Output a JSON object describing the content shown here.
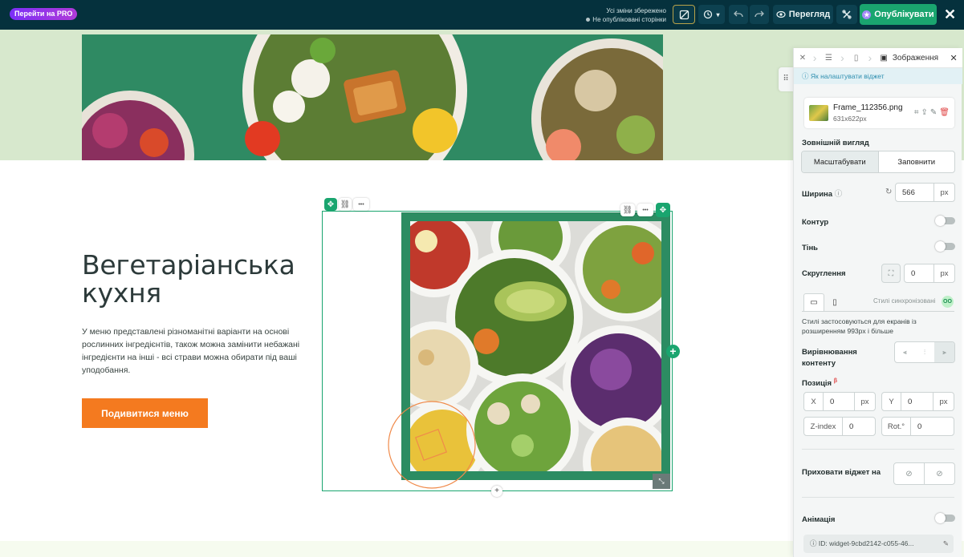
{
  "topbar": {
    "pro_label": "Перейти на PRO",
    "saved_status": "Усі зміни збережено",
    "unpublished_status": "Не опубліковані сторінки",
    "preview_label": "Перегляд",
    "publish_label": "Опублікувати",
    "close_symbol": "✕"
  },
  "hero": {
    "title": "Вегетаріанська кухня",
    "text": "У меню представлені різноманітні варіанти на основі рослинних інгредієнтів, також можна замінити небажані інгредієнти на інші - всі страви можна обирати під ваші уподобання.",
    "button_label": "Подивитися меню"
  },
  "widget": {
    "more_symbol": "•••",
    "plus_symbol": "+"
  },
  "panel": {
    "breadcrumb_current": "Зображення",
    "help_link": "Як налаштувати віджет",
    "file": {
      "name": "Frame_112356.png",
      "size": "631x622px"
    },
    "appearance_label": "Зовнішній вигляд",
    "fit_options": [
      "Масштабувати",
      "Заповнити"
    ],
    "width": {
      "label": "Ширина",
      "value": "566",
      "unit": "px"
    },
    "outline_label": "Контур",
    "shadow_label": "Тінь",
    "radius": {
      "label": "Скруглення",
      "value": "0",
      "unit": "px"
    },
    "styles_synced": "Стилі синхронізовані",
    "sync_badge": "OO",
    "styles_note": "Стилі застосовуються для екранів із розширенням 993px і більше",
    "content_align_label": "Вирівнювання контенту",
    "position_label": "Позиція",
    "beta": "β",
    "x": {
      "label": "X",
      "value": "0",
      "unit": "px"
    },
    "y": {
      "label": "Y",
      "value": "0",
      "unit": "px"
    },
    "zindex": {
      "label": "Z-index",
      "value": "0"
    },
    "rotation": {
      "label": "Rot.°",
      "value": "0"
    },
    "hide_on_label": "Приховати віджет на",
    "animation_label": "Анімація",
    "widget_id": "ID: widget-9cbd2142-c055-46..."
  },
  "colors": {
    "topbar": "#05313d",
    "accent_green": "#1aa56f",
    "cta_orange": "#f47a1f",
    "hero_bg": "#d7e8cd"
  }
}
